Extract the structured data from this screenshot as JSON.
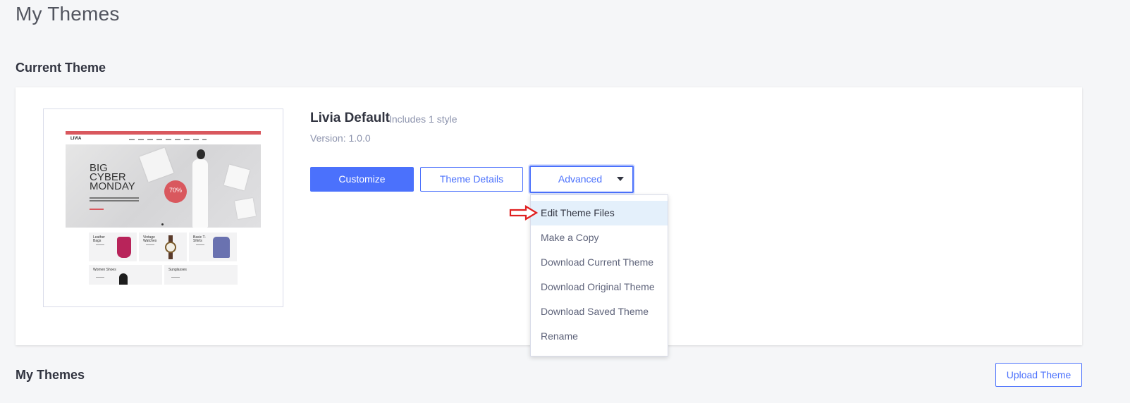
{
  "page": {
    "title": "My Themes"
  },
  "current_theme": {
    "section_title": "Current Theme",
    "name": "Livia Default",
    "styles_note": "Includes 1 style",
    "version": "Version: 1.0.0",
    "preview": {
      "logo": "LIVIA",
      "hero_text": "BIG CYBER MONDAY",
      "badge": "70%",
      "tiles": [
        "Leather Bags",
        "Vintage Watches",
        "Basic T-Shirts",
        "Women Shoes",
        "Sunglasses"
      ]
    },
    "buttons": {
      "customize": "Customize",
      "details": "Theme Details",
      "advanced": "Advanced"
    }
  },
  "advanced_menu": {
    "items": [
      {
        "label": "Edit Theme Files",
        "active": true
      },
      {
        "label": "Make a Copy"
      },
      {
        "label": "Download Current Theme"
      },
      {
        "label": "Download Original Theme"
      },
      {
        "label": "Download Saved Theme"
      },
      {
        "label": "Rename"
      }
    ]
  },
  "my_themes": {
    "section_title": "My Themes",
    "upload_button": "Upload Theme"
  },
  "colors": {
    "primary": "#4b71fc",
    "background": "#f5f6f8",
    "menu_highlight": "#e4f0fb",
    "annotation_arrow": "#e02020"
  }
}
